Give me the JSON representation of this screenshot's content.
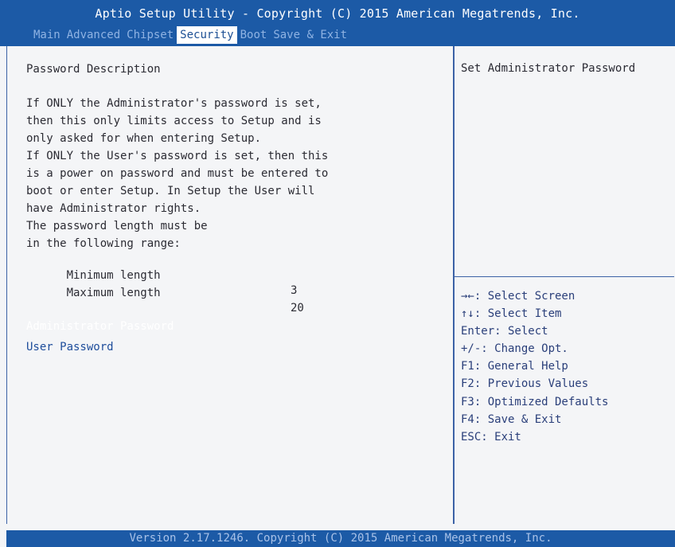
{
  "header": {
    "title": "Aptio Setup Utility - Copyright (C) 2015 American Megatrends, Inc.",
    "tabs": [
      "Main",
      "Advanced",
      "Chipset",
      "Security",
      "Boot",
      "Save & Exit"
    ],
    "active_tab": "Security"
  },
  "main": {
    "section_title": "Password Description",
    "description_lines": [
      "If ONLY the Administrator's password is set,",
      "then this only limits access to Setup and is",
      "only asked for when entering Setup.",
      "If ONLY the User's password is set, then this",
      "is a power on password and must be entered to",
      "boot or enter Setup. In Setup the User will",
      "have Administrator rights.",
      "The password length must be",
      "in the following range:"
    ],
    "min_label": "Minimum length",
    "min_value": "3",
    "max_label": "Maximum length",
    "max_value": "20",
    "menu_items": [
      "Administrator Password",
      "User Password"
    ]
  },
  "help": {
    "description": "Set Administrator Password",
    "keys": [
      "→←: Select Screen",
      "↑↓: Select Item",
      "Enter: Select",
      "+/-: Change Opt.",
      "F1: General Help",
      "F2: Previous Values",
      "F3: Optimized Defaults",
      "F4: Save & Exit",
      "ESC: Exit"
    ]
  },
  "footer": {
    "text": "Version 2.17.1246. Copyright (C) 2015 American Megatrends, Inc."
  },
  "colors": {
    "bar_blue": "#1c5aa6",
    "divider_blue": "#3c62a6",
    "panel_bg": "#f4f5f7",
    "selected_item": "#ffffff",
    "menu_item": "#1e4d9b"
  }
}
